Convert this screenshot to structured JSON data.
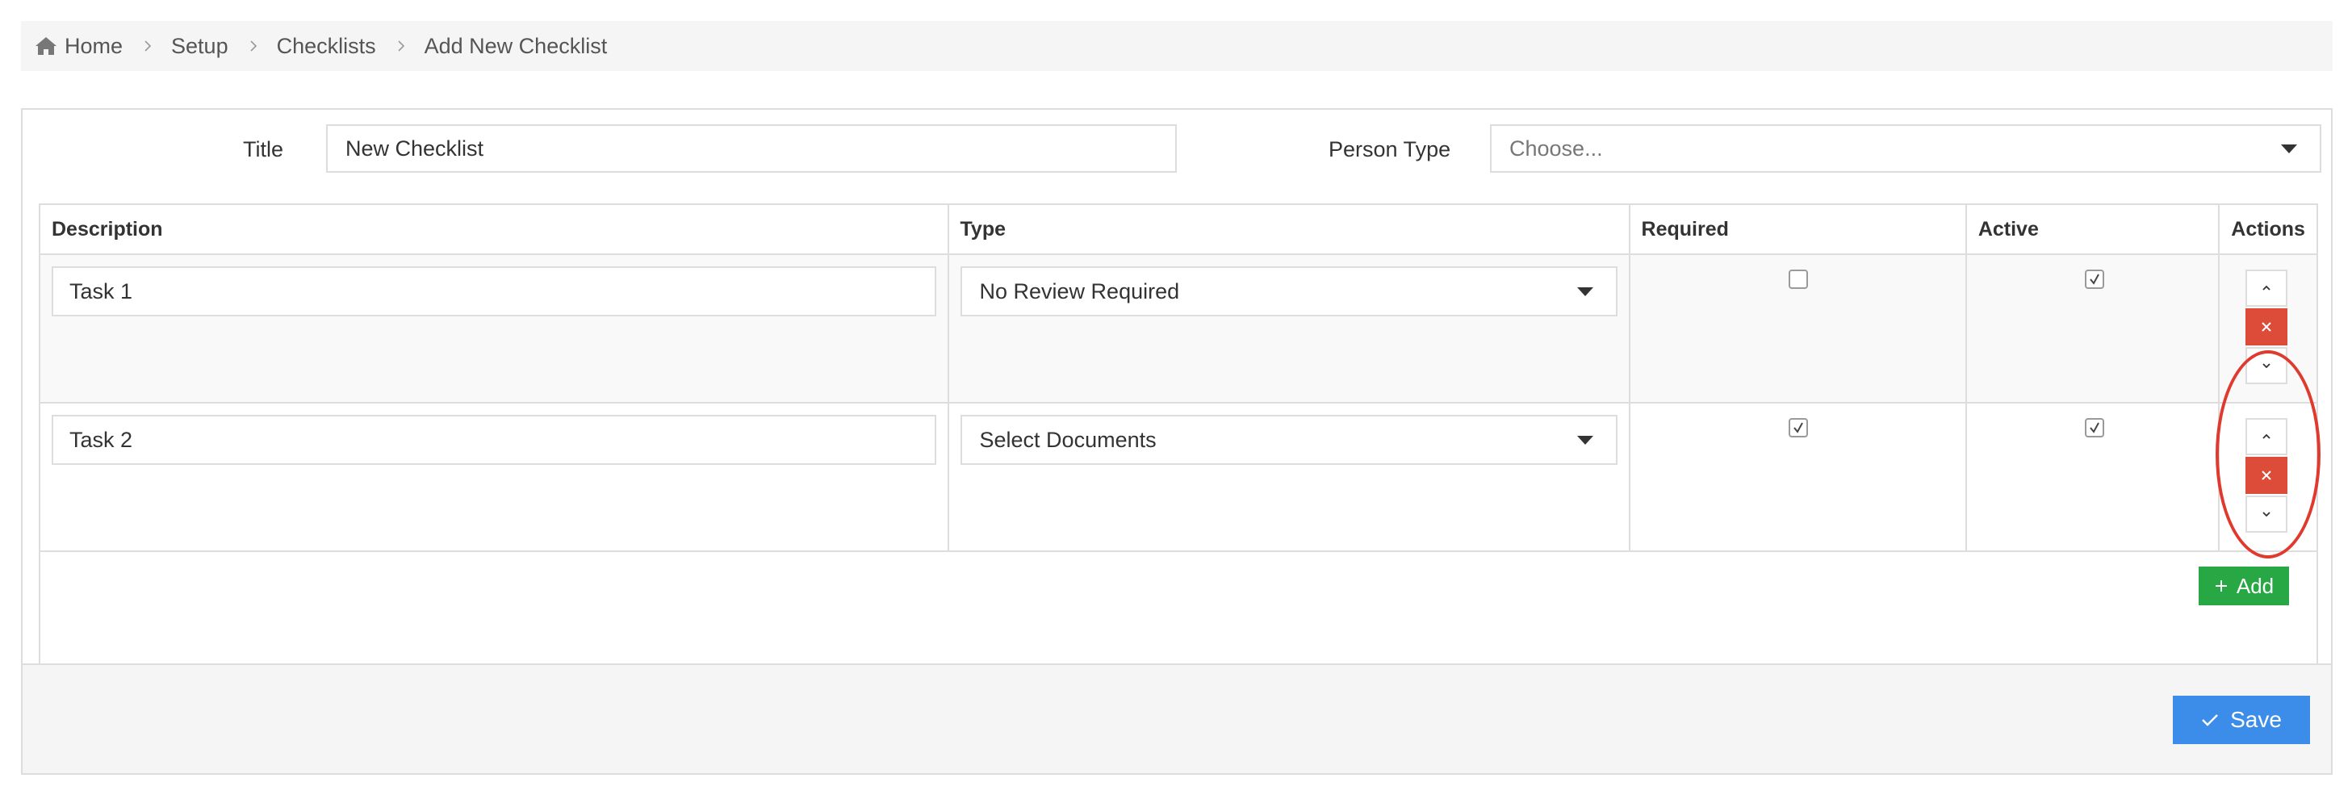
{
  "breadcrumb": {
    "items": [
      "Home",
      "Setup",
      "Checklists",
      "Add New Checklist"
    ]
  },
  "form": {
    "title_label": "Title",
    "title_value": "New Checklist",
    "person_type_label": "Person Type",
    "person_type_value": "Choose..."
  },
  "table": {
    "headers": [
      "Description",
      "Type",
      "Required",
      "Active",
      "Actions"
    ],
    "rows": [
      {
        "description": "Task 1",
        "type": "No Review Required",
        "required": false,
        "active": true
      },
      {
        "description": "Task 2",
        "type": "Select Documents",
        "required": true,
        "active": true
      }
    ],
    "add_label": "Add"
  },
  "footer": {
    "save_label": "Save"
  },
  "colors": {
    "delete": "#dd4b39",
    "add": "#28a745",
    "save": "#3c8dea",
    "annotation": "#e03a2e"
  }
}
